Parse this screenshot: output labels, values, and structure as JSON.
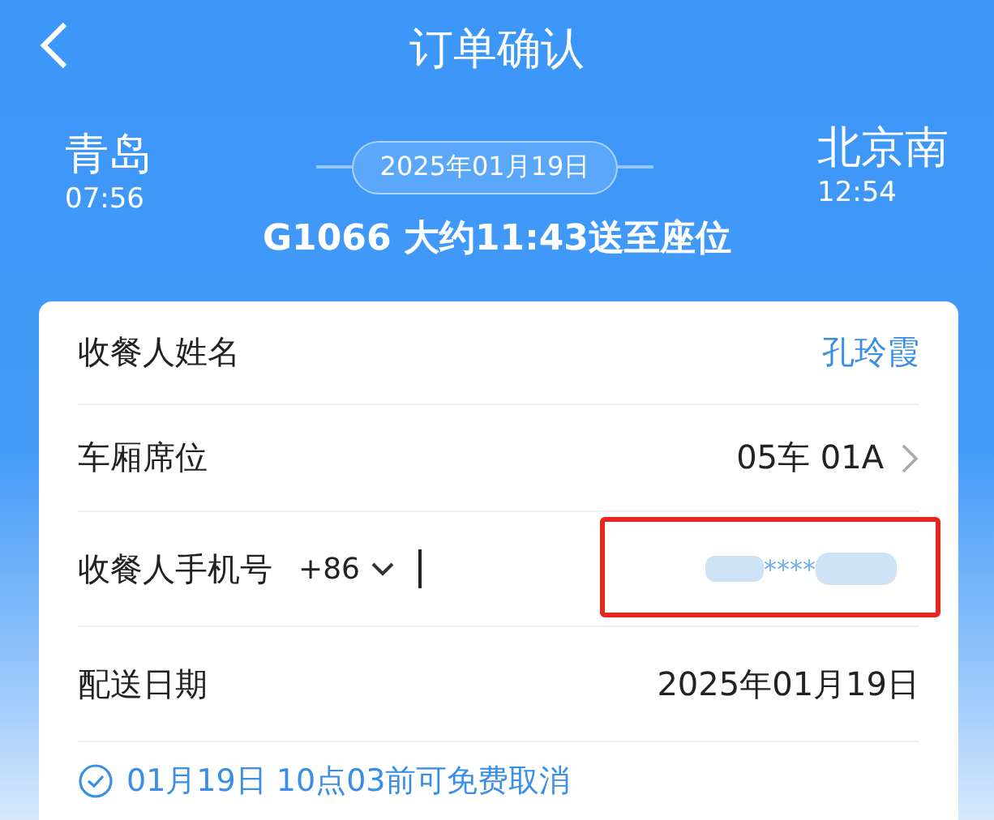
{
  "header": {
    "title": "订单确认"
  },
  "trip": {
    "from": {
      "station": "青岛",
      "time": "07:56"
    },
    "date": "2025年01月19日",
    "to": {
      "station": "北京南",
      "time": "12:54"
    },
    "summary": "G1066 大约11:43送至座位"
  },
  "form": {
    "rows": [
      {
        "kind": "link",
        "label": "收餐人姓名",
        "value": "孔玲霞"
      },
      {
        "kind": "select",
        "label": "车厢席位",
        "value": "05车 01A"
      },
      {
        "kind": "phone",
        "label": "收餐人手机号",
        "code": "+86",
        "value": "****",
        "highlighted": true
      },
      {
        "kind": "text",
        "label": "配送日期",
        "value": "2025年01月19日"
      }
    ]
  },
  "notice": "01月19日 10点03前可免费取消"
}
